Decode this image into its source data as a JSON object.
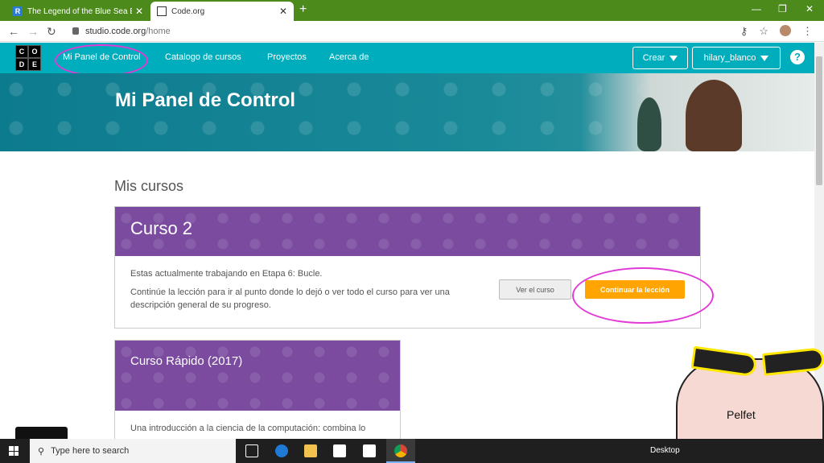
{
  "browser": {
    "tabs": [
      {
        "title": "The Legend of the Blue Sea Episo",
        "favicon": "R",
        "active": false
      },
      {
        "title": "Code.org",
        "active": true
      }
    ],
    "url_host": "studio.code.org",
    "url_path": "/home"
  },
  "header": {
    "logo_letters": [
      "C",
      "O",
      "D",
      "E"
    ],
    "nav": [
      "Mi Panel de Control",
      "Catalogo de cursos",
      "Proyectos",
      "Acerca de"
    ],
    "create_label": "Crear",
    "user_label": "hilary_blanco",
    "help_glyph": "?",
    "brand_color": "#00adbc"
  },
  "banner": {
    "title": "Mi Panel de Control"
  },
  "main": {
    "section_title": "Mis cursos",
    "courses": [
      {
        "title": "Curso 2",
        "status": "Estas actualmente trabajando en Etapa 6: Bucle.",
        "description": "Continúe la lección para ir al punto donde lo dejó o ver todo el curso para ver una descripción general de su progreso.",
        "view_label": "Ver el curso",
        "continue_label": "Continuar la lección"
      },
      {
        "title": "Curso Rápido (2017)",
        "description": "Una introducción a la ciencia de la computación: combina lo"
      }
    ]
  },
  "taskbar": {
    "search_placeholder": "Type here to search",
    "desktop_label": "Desktop"
  },
  "sticker": {
    "label": "Pelfet"
  },
  "colors": {
    "accent_purple": "#7b4ba0",
    "button_orange": "#ffa400",
    "annotation_pink": "#e23ad6"
  }
}
